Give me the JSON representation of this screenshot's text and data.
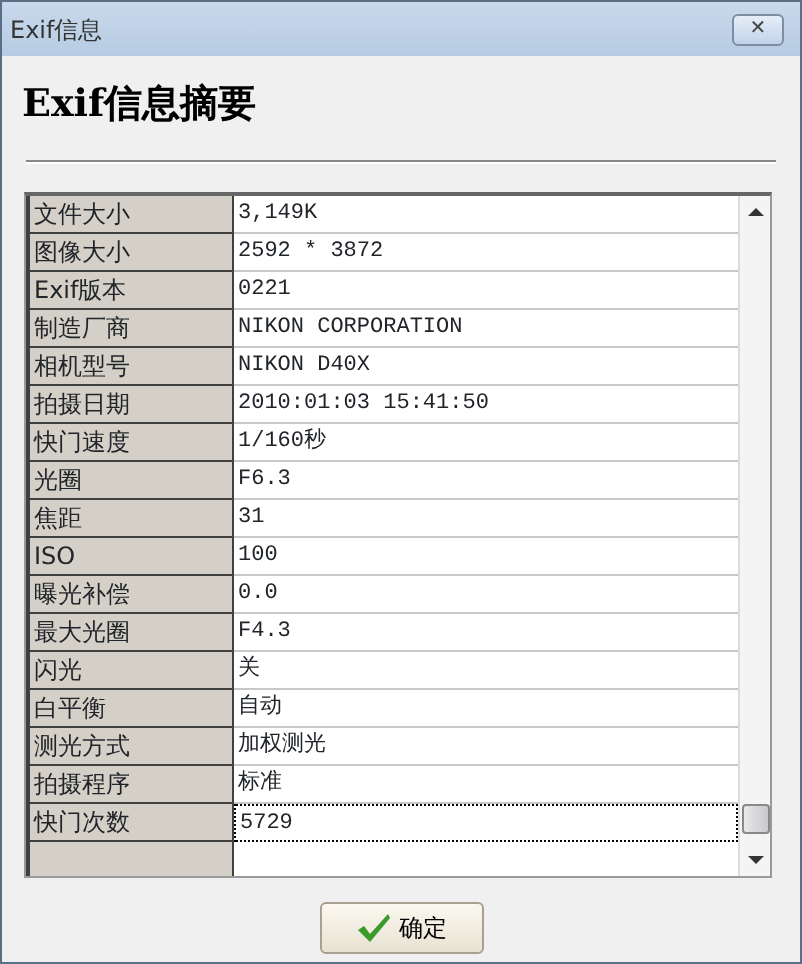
{
  "window": {
    "title": "Exif信息",
    "close": "✕"
  },
  "heading": "Exif信息摘要",
  "rows": [
    {
      "label": "文件大小",
      "value": "3,149K",
      "focused": false
    },
    {
      "label": "图像大小",
      "value": "2592 * 3872",
      "focused": false
    },
    {
      "label": "Exif版本",
      "value": "0221",
      "focused": false
    },
    {
      "label": "制造厂商",
      "value": "NIKON CORPORATION",
      "focused": false
    },
    {
      "label": "相机型号",
      "value": "NIKON D40X",
      "focused": false
    },
    {
      "label": "拍摄日期",
      "value": "2010:01:03 15:41:50",
      "focused": false
    },
    {
      "label": "快门速度",
      "value": "1/160秒",
      "focused": false
    },
    {
      "label": "光圈",
      "value": "F6.3",
      "focused": false
    },
    {
      "label": "焦距",
      "value": "31",
      "focused": false
    },
    {
      "label": "ISO",
      "value": "100",
      "focused": false
    },
    {
      "label": "曝光补偿",
      "value": "0.0",
      "focused": false
    },
    {
      "label": "最大光圈",
      "value": "F4.3",
      "focused": false
    },
    {
      "label": "闪光",
      "value": "关",
      "focused": false
    },
    {
      "label": "白平衡",
      "value": "自动",
      "focused": false
    },
    {
      "label": "测光方式",
      "value": "加权测光",
      "focused": false
    },
    {
      "label": "拍摄程序",
      "value": "标准",
      "focused": false
    },
    {
      "label": "快门次数",
      "value": "5729",
      "focused": true
    }
  ],
  "ok_button": "确定"
}
